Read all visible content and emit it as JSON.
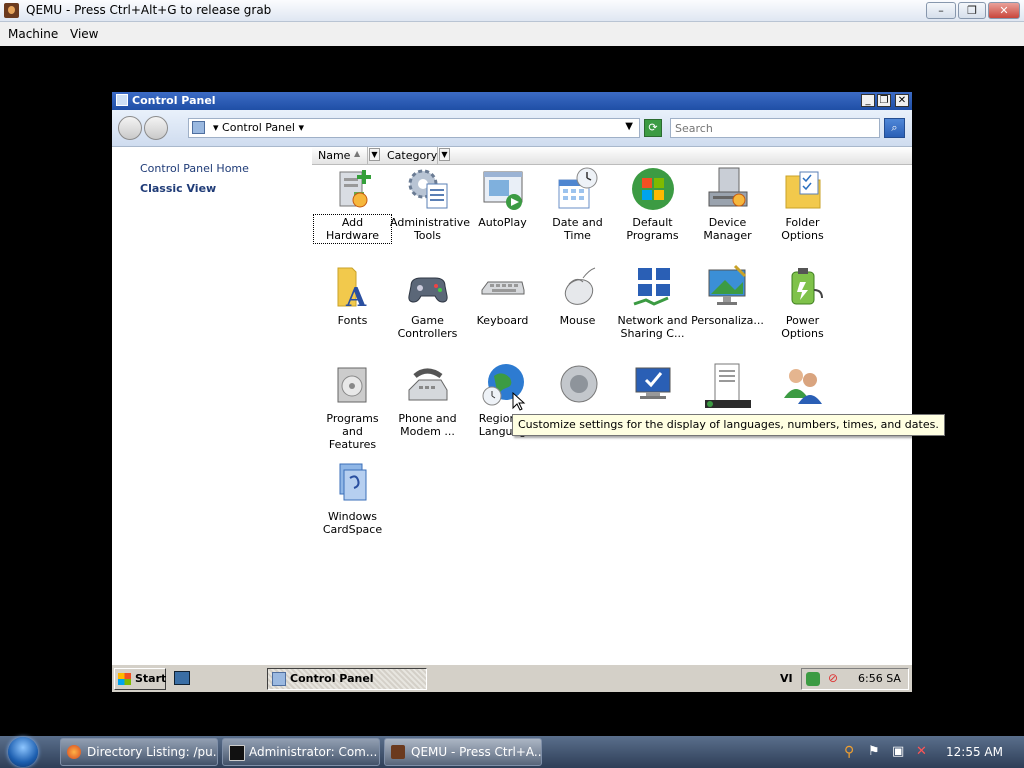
{
  "host": {
    "title": "QEMU - Press Ctrl+Alt+G to release grab",
    "menu": [
      "Machine",
      "View"
    ],
    "controls": {
      "minimize": "–",
      "restore": "❐",
      "close": "✕"
    }
  },
  "control_panel": {
    "title": "Control Panel",
    "address": "Control Panel",
    "search_placeholder": "Search",
    "left_links": [
      "Control Panel Home",
      "Classic View"
    ],
    "columns": [
      "Name",
      "Category"
    ],
    "items": [
      {
        "label": "Add Hardware",
        "icon": "add-hardware-icon"
      },
      {
        "label": "Administrative\nTools",
        "icon": "administrative-tools-icon"
      },
      {
        "label": "AutoPlay",
        "icon": "autoplay-icon"
      },
      {
        "label": "Date and Time",
        "icon": "date-and-time-icon"
      },
      {
        "label": "Default\nPrograms",
        "icon": "default-programs-icon"
      },
      {
        "label": "Device\nManager",
        "icon": "device-manager-icon"
      },
      {
        "label": "Folder Options",
        "icon": "folder-options-icon"
      },
      {
        "label": "Fonts",
        "icon": "fonts-icon"
      },
      {
        "label": "Game\nControllers",
        "icon": "game-controllers-icon"
      },
      {
        "label": "Keyboard",
        "icon": "keyboard-icon"
      },
      {
        "label": "Mouse",
        "icon": "mouse-icon"
      },
      {
        "label": "Network and\nSharing C...",
        "icon": "network-sharing-icon"
      },
      {
        "label": "Personaliza...",
        "icon": "personalization-icon"
      },
      {
        "label": "Power Options",
        "icon": "power-options-icon"
      },
      {
        "label": "Programs and\nFeatures",
        "icon": "programs-features-icon"
      },
      {
        "label": "Phone and\nModem ...",
        "icon": "phone-modem-icon"
      },
      {
        "label": "Regional\nLanguag",
        "icon": "regional-language-icon"
      },
      {
        "label": "",
        "icon": "sound-icon"
      },
      {
        "label": "",
        "icon": "system-icon"
      },
      {
        "label": "",
        "icon": "taskbar-icon"
      },
      {
        "label": "",
        "icon": "user-accounts-icon"
      },
      {
        "label": "Windows\nCardSpace",
        "icon": "windows-cardspace-icon"
      }
    ],
    "tooltip": "Customize settings for the display of languages, numbers, times, and dates."
  },
  "guest_taskbar": {
    "start": "Start",
    "active_window": "Control Panel",
    "lang": "VI",
    "time": "6:56 SA"
  },
  "host_taskbar": {
    "buttons": [
      "Directory Listing: /pu...",
      "Administrator: Com...",
      "QEMU - Press Ctrl+A..."
    ],
    "time": "12:55 AM"
  }
}
